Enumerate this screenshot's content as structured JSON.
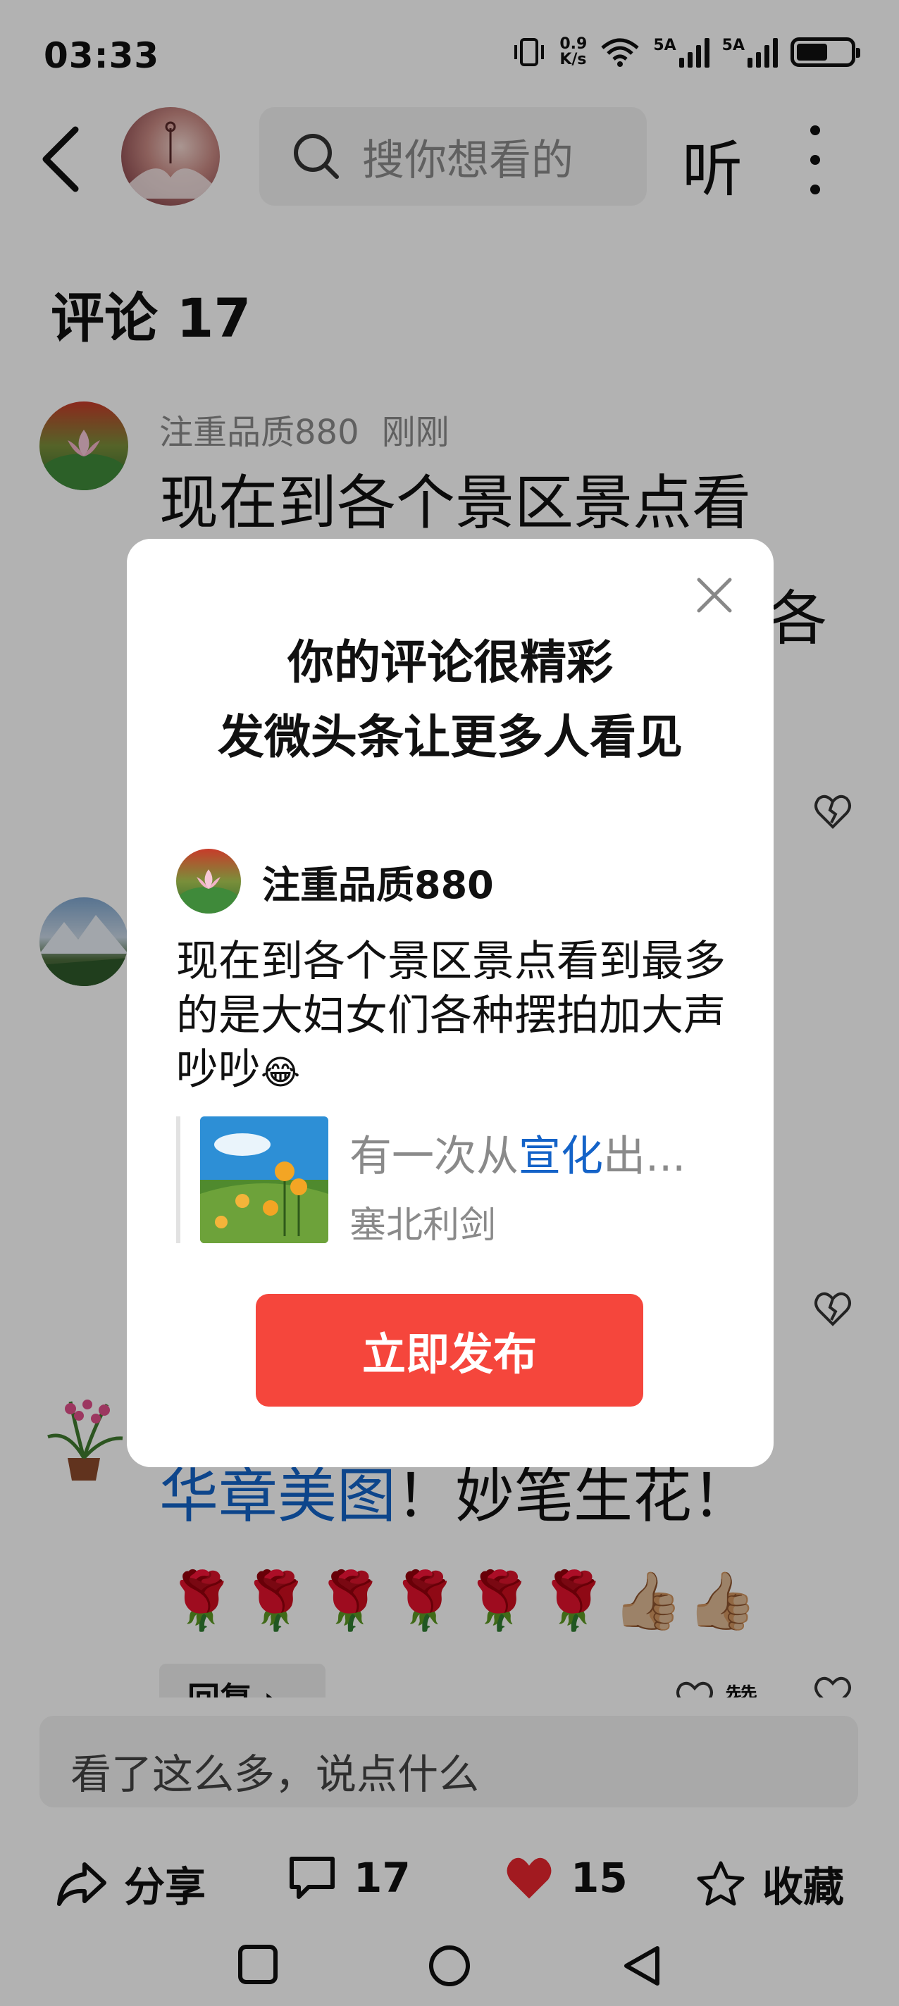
{
  "status_bar": {
    "time": "03:33",
    "net_speed_value": "0.9",
    "net_speed_unit": "K/s",
    "sim1_label": "5A",
    "sim2_label": "5A",
    "icons": [
      "vibrate-icon",
      "wifi-icon",
      "signal-icon",
      "signal-icon",
      "battery-icon"
    ]
  },
  "header": {
    "search_placeholder": "搜你想看的",
    "listen_label": "听",
    "icons": [
      "back-arrow-icon",
      "search-icon",
      "more-vertical-icon"
    ]
  },
  "comments": {
    "title": "评论 17",
    "items": [
      {
        "username": "注重品质880",
        "time": "刚刚",
        "text_visible_line": "现在到各个景区景点看",
        "text_visible_fragment": "各"
      },
      {
        "text_link": "华章美图",
        "text_rest": "！妙笔生花！",
        "emoji_line": "🌹🌹🌹🌹🌹🌹👍🏼👍🏼"
      }
    ],
    "reply_label": "回复 ›",
    "like_label": "赞"
  },
  "bottom_bar": {
    "input_placeholder": "看了这么多，说点什么",
    "share_label": "分享",
    "comment_count": "17",
    "like_count": "15",
    "favorite_label": "收藏",
    "accent_like_color": "#e8262f"
  },
  "modal": {
    "title_line1": "你的评论很精彩",
    "title_line2": "发微头条让更多人看见",
    "username": "注重品质880",
    "comment_text": "现在到各个景区景点看到最多的是大妇女们各种摆拍加大声吵吵",
    "comment_emoji": "😂",
    "quote_title_prefix": "有一次从",
    "quote_title_highlight": "宣化",
    "quote_title_suffix": "出...",
    "quote_author": "塞北利剑",
    "publish_button": "立即发布",
    "button_color": "#f5463c",
    "highlight_color": "#1463c8"
  }
}
